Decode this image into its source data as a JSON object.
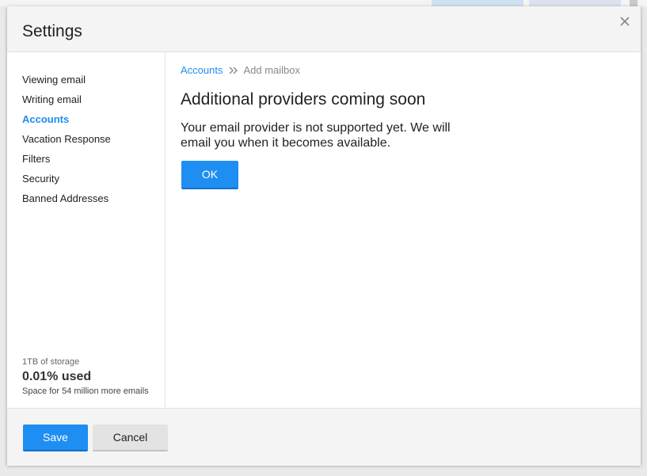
{
  "dialog": {
    "title": "Settings",
    "close_icon": "close-icon"
  },
  "sidebar": {
    "items": [
      {
        "label": "Viewing email",
        "active": false
      },
      {
        "label": "Writing email",
        "active": false
      },
      {
        "label": "Accounts",
        "active": true
      },
      {
        "label": "Vacation Response",
        "active": false
      },
      {
        "label": "Filters",
        "active": false
      },
      {
        "label": "Security",
        "active": false
      },
      {
        "label": "Banned Addresses",
        "active": false
      }
    ],
    "storage": {
      "capacity": "1TB of storage",
      "used": "0.01% used",
      "space": "Space for 54 million more emails"
    }
  },
  "content": {
    "breadcrumb": {
      "link": "Accounts",
      "separator_icon": "double-chevron-right-icon",
      "current": "Add mailbox"
    },
    "title": "Additional providers coming soon",
    "message": "Your email provider is not supported yet. We will email you when it becomes available.",
    "ok_label": "OK"
  },
  "footer": {
    "save_label": "Save",
    "cancel_label": "Cancel"
  },
  "colors": {
    "accent": "#1e8ef2",
    "header_bg": "#f4f4f4",
    "cancel_bg": "#e3e3e3"
  }
}
